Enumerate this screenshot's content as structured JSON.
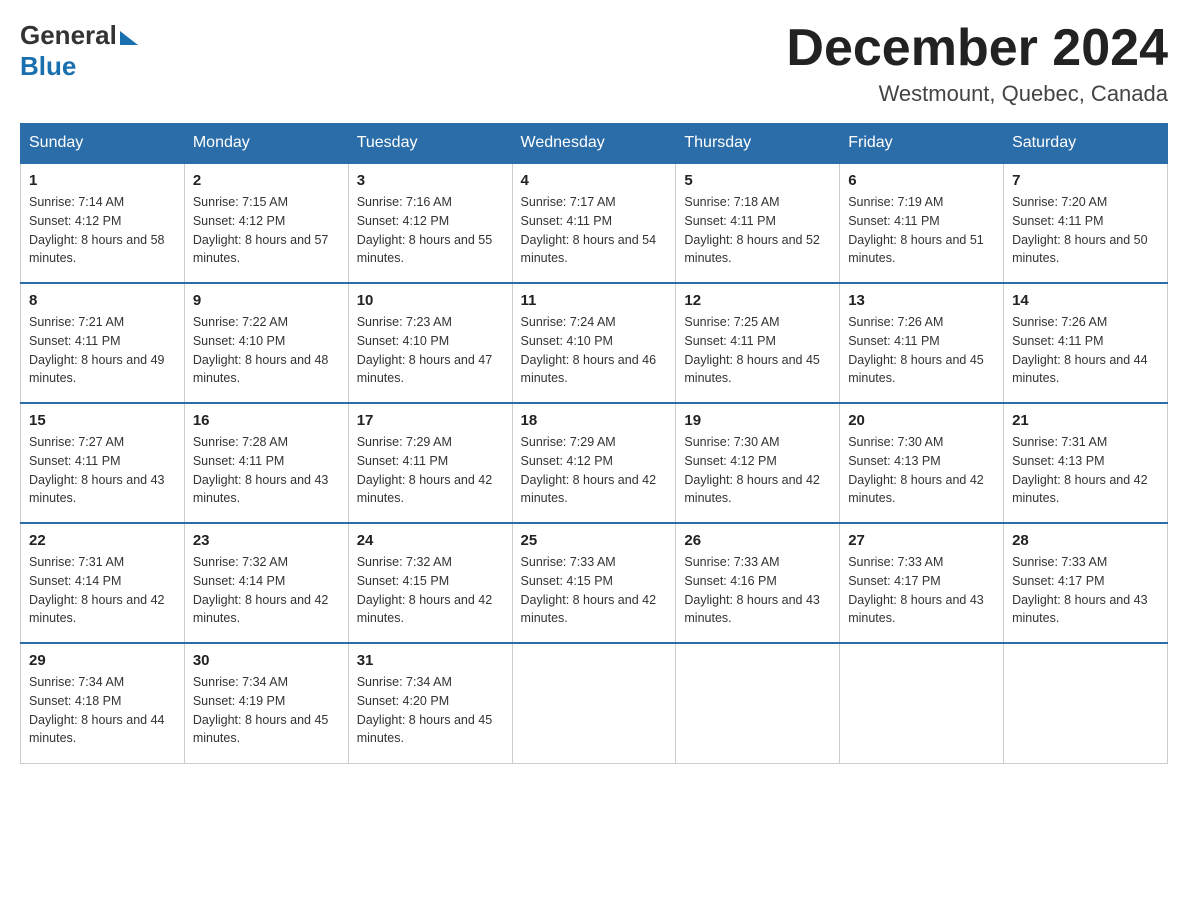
{
  "header": {
    "logo_line1": "General",
    "logo_line2": "Blue",
    "month_title": "December 2024",
    "location": "Westmount, Quebec, Canada"
  },
  "days_of_week": [
    "Sunday",
    "Monday",
    "Tuesday",
    "Wednesday",
    "Thursday",
    "Friday",
    "Saturday"
  ],
  "weeks": [
    [
      {
        "day": "1",
        "sunrise": "7:14 AM",
        "sunset": "4:12 PM",
        "daylight": "8 hours and 58 minutes."
      },
      {
        "day": "2",
        "sunrise": "7:15 AM",
        "sunset": "4:12 PM",
        "daylight": "8 hours and 57 minutes."
      },
      {
        "day": "3",
        "sunrise": "7:16 AM",
        "sunset": "4:12 PM",
        "daylight": "8 hours and 55 minutes."
      },
      {
        "day": "4",
        "sunrise": "7:17 AM",
        "sunset": "4:11 PM",
        "daylight": "8 hours and 54 minutes."
      },
      {
        "day": "5",
        "sunrise": "7:18 AM",
        "sunset": "4:11 PM",
        "daylight": "8 hours and 52 minutes."
      },
      {
        "day": "6",
        "sunrise": "7:19 AM",
        "sunset": "4:11 PM",
        "daylight": "8 hours and 51 minutes."
      },
      {
        "day": "7",
        "sunrise": "7:20 AM",
        "sunset": "4:11 PM",
        "daylight": "8 hours and 50 minutes."
      }
    ],
    [
      {
        "day": "8",
        "sunrise": "7:21 AM",
        "sunset": "4:11 PM",
        "daylight": "8 hours and 49 minutes."
      },
      {
        "day": "9",
        "sunrise": "7:22 AM",
        "sunset": "4:10 PM",
        "daylight": "8 hours and 48 minutes."
      },
      {
        "day": "10",
        "sunrise": "7:23 AM",
        "sunset": "4:10 PM",
        "daylight": "8 hours and 47 minutes."
      },
      {
        "day": "11",
        "sunrise": "7:24 AM",
        "sunset": "4:10 PM",
        "daylight": "8 hours and 46 minutes."
      },
      {
        "day": "12",
        "sunrise": "7:25 AM",
        "sunset": "4:11 PM",
        "daylight": "8 hours and 45 minutes."
      },
      {
        "day": "13",
        "sunrise": "7:26 AM",
        "sunset": "4:11 PM",
        "daylight": "8 hours and 45 minutes."
      },
      {
        "day": "14",
        "sunrise": "7:26 AM",
        "sunset": "4:11 PM",
        "daylight": "8 hours and 44 minutes."
      }
    ],
    [
      {
        "day": "15",
        "sunrise": "7:27 AM",
        "sunset": "4:11 PM",
        "daylight": "8 hours and 43 minutes."
      },
      {
        "day": "16",
        "sunrise": "7:28 AM",
        "sunset": "4:11 PM",
        "daylight": "8 hours and 43 minutes."
      },
      {
        "day": "17",
        "sunrise": "7:29 AM",
        "sunset": "4:11 PM",
        "daylight": "8 hours and 42 minutes."
      },
      {
        "day": "18",
        "sunrise": "7:29 AM",
        "sunset": "4:12 PM",
        "daylight": "8 hours and 42 minutes."
      },
      {
        "day": "19",
        "sunrise": "7:30 AM",
        "sunset": "4:12 PM",
        "daylight": "8 hours and 42 minutes."
      },
      {
        "day": "20",
        "sunrise": "7:30 AM",
        "sunset": "4:13 PM",
        "daylight": "8 hours and 42 minutes."
      },
      {
        "day": "21",
        "sunrise": "7:31 AM",
        "sunset": "4:13 PM",
        "daylight": "8 hours and 42 minutes."
      }
    ],
    [
      {
        "day": "22",
        "sunrise": "7:31 AM",
        "sunset": "4:14 PM",
        "daylight": "8 hours and 42 minutes."
      },
      {
        "day": "23",
        "sunrise": "7:32 AM",
        "sunset": "4:14 PM",
        "daylight": "8 hours and 42 minutes."
      },
      {
        "day": "24",
        "sunrise": "7:32 AM",
        "sunset": "4:15 PM",
        "daylight": "8 hours and 42 minutes."
      },
      {
        "day": "25",
        "sunrise": "7:33 AM",
        "sunset": "4:15 PM",
        "daylight": "8 hours and 42 minutes."
      },
      {
        "day": "26",
        "sunrise": "7:33 AM",
        "sunset": "4:16 PM",
        "daylight": "8 hours and 43 minutes."
      },
      {
        "day": "27",
        "sunrise": "7:33 AM",
        "sunset": "4:17 PM",
        "daylight": "8 hours and 43 minutes."
      },
      {
        "day": "28",
        "sunrise": "7:33 AM",
        "sunset": "4:17 PM",
        "daylight": "8 hours and 43 minutes."
      }
    ],
    [
      {
        "day": "29",
        "sunrise": "7:34 AM",
        "sunset": "4:18 PM",
        "daylight": "8 hours and 44 minutes."
      },
      {
        "day": "30",
        "sunrise": "7:34 AM",
        "sunset": "4:19 PM",
        "daylight": "8 hours and 45 minutes."
      },
      {
        "day": "31",
        "sunrise": "7:34 AM",
        "sunset": "4:20 PM",
        "daylight": "8 hours and 45 minutes."
      },
      null,
      null,
      null,
      null
    ]
  ],
  "labels": {
    "sunrise_prefix": "Sunrise: ",
    "sunset_prefix": "Sunset: ",
    "daylight_prefix": "Daylight: "
  }
}
